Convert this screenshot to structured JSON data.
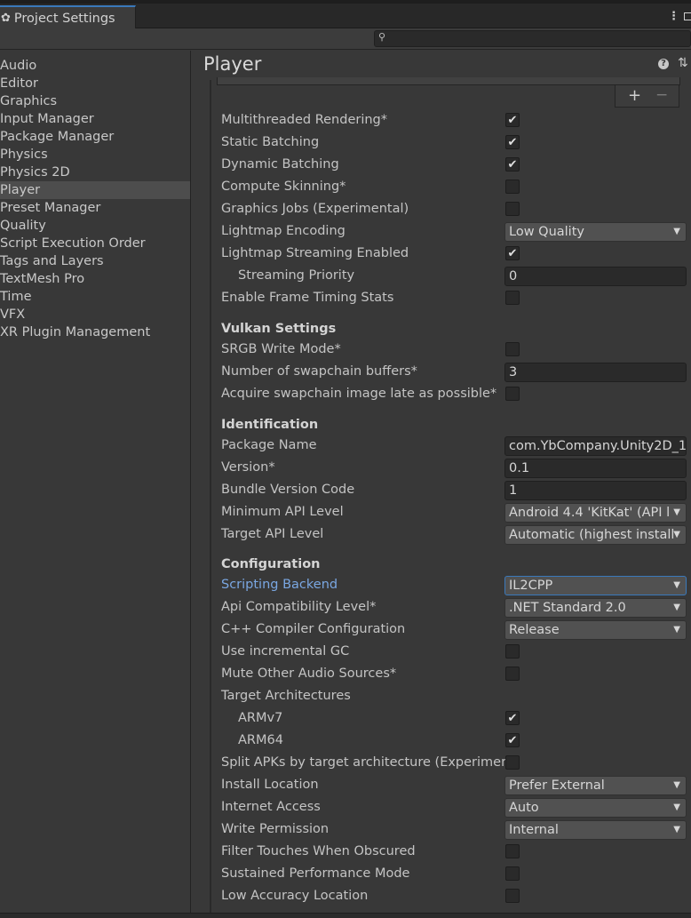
{
  "window": {
    "tab_title": "Project Settings",
    "tab_icon": "gear-icon"
  },
  "search": {
    "placeholder": ""
  },
  "sidebar": {
    "items": [
      {
        "label": "Audio"
      },
      {
        "label": "Editor"
      },
      {
        "label": "Graphics"
      },
      {
        "label": "Input Manager"
      },
      {
        "label": "Package Manager"
      },
      {
        "label": "Physics"
      },
      {
        "label": "Physics 2D"
      },
      {
        "label": "Player",
        "selected": true
      },
      {
        "label": "Preset Manager"
      },
      {
        "label": "Quality"
      },
      {
        "label": "Script Execution Order"
      },
      {
        "label": "Tags and Layers"
      },
      {
        "label": "TextMesh Pro"
      },
      {
        "label": "Time"
      },
      {
        "label": "VFX"
      },
      {
        "label": "XR Plugin Management"
      }
    ]
  },
  "main": {
    "title": "Player",
    "list_controls": {
      "plus": "+",
      "minus": "−"
    },
    "rendering": [
      {
        "label": "Multithreaded Rendering*",
        "type": "checkbox",
        "checked": true
      },
      {
        "label": "Static Batching",
        "type": "checkbox",
        "checked": true
      },
      {
        "label": "Dynamic Batching",
        "type": "checkbox",
        "checked": true
      },
      {
        "label": "Compute Skinning*",
        "type": "checkbox",
        "checked": false
      },
      {
        "label": "Graphics Jobs (Experimental)",
        "type": "checkbox",
        "checked": false
      },
      {
        "label": "Lightmap Encoding",
        "type": "dropdown",
        "value": "Low Quality"
      },
      {
        "label": "Lightmap Streaming Enabled",
        "type": "checkbox",
        "checked": true
      },
      {
        "label": "Streaming Priority",
        "type": "text",
        "value": "0",
        "indent": true
      },
      {
        "label": "Enable Frame Timing Stats",
        "type": "checkbox",
        "checked": false
      }
    ],
    "vulkan": {
      "heading": "Vulkan Settings",
      "fields": [
        {
          "label": "SRGB Write Mode*",
          "type": "checkbox",
          "checked": false
        },
        {
          "label": "Number of swapchain buffers*",
          "type": "text",
          "value": "3"
        },
        {
          "label": "Acquire swapchain image late as possible*",
          "type": "checkbox",
          "checked": false
        }
      ]
    },
    "identification": {
      "heading": "Identification",
      "fields": [
        {
          "label": "Package Name",
          "type": "text",
          "value": "com.YbCompany.Unity2D_1"
        },
        {
          "label": "Version*",
          "type": "text",
          "value": "0.1"
        },
        {
          "label": "Bundle Version Code",
          "type": "text",
          "value": "1"
        },
        {
          "label": "Minimum API Level",
          "type": "dropdown",
          "value": "Android 4.4 'KitKat' (API l"
        },
        {
          "label": "Target API Level",
          "type": "dropdown",
          "value": "Automatic (highest install"
        }
      ]
    },
    "configuration": {
      "heading": "Configuration",
      "fields": [
        {
          "label": "Scripting Backend",
          "type": "dropdown",
          "value": "IL2CPP",
          "focused": true
        },
        {
          "label": "Api Compatibility Level*",
          "type": "dropdown",
          "value": ".NET Standard 2.0"
        },
        {
          "label": "C++ Compiler Configuration",
          "type": "dropdown",
          "value": "Release"
        },
        {
          "label": "Use incremental GC",
          "type": "checkbox",
          "checked": false
        },
        {
          "label": "Mute Other Audio Sources*",
          "type": "checkbox",
          "checked": false
        },
        {
          "label": "Target Architectures",
          "type": "label"
        },
        {
          "label": "ARMv7",
          "type": "checkbox",
          "checked": true,
          "indent": true
        },
        {
          "label": "ARM64",
          "type": "checkbox",
          "checked": true,
          "indent": true
        },
        {
          "label": "Split APKs by target architecture (Experimen",
          "type": "checkbox",
          "checked": false
        },
        {
          "label": "Install Location",
          "type": "dropdown",
          "value": "Prefer External"
        },
        {
          "label": "Internet Access",
          "type": "dropdown",
          "value": "Auto"
        },
        {
          "label": "Write Permission",
          "type": "dropdown",
          "value": "Internal"
        },
        {
          "label": "Filter Touches When Obscured",
          "type": "checkbox",
          "checked": false
        },
        {
          "label": "Sustained Performance Mode",
          "type": "checkbox",
          "checked": false
        },
        {
          "label": "Low Accuracy Location",
          "type": "checkbox",
          "checked": false
        }
      ]
    }
  },
  "colors": {
    "panel_bg": "#383838",
    "selected_bg": "#4d4d4d",
    "accent": "#3a79bb",
    "link": "#7aa7e2"
  }
}
